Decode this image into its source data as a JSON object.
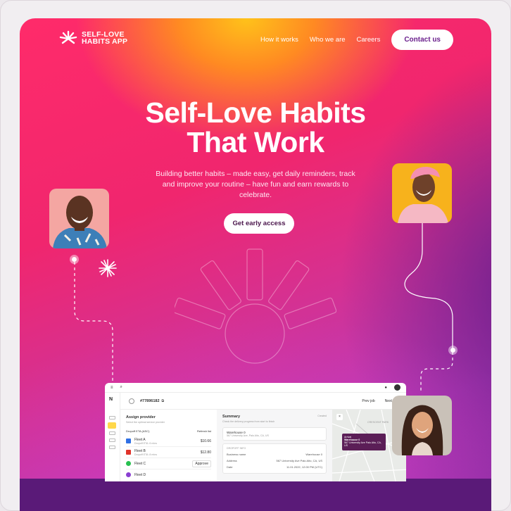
{
  "brand": {
    "name_line1": "SELF-LOVE",
    "name_line2": "HABITS APP"
  },
  "nav": {
    "items": [
      "How it works",
      "Who we are",
      "Careers"
    ],
    "contact": "Contact us"
  },
  "hero": {
    "title_line1": "Self-Love Habits",
    "title_line2": "That Work",
    "subtitle": "Building better habits – made easy, get daily reminders, track and improve your routine – have fun and earn rewards to celebrate.",
    "cta": "Get early access"
  },
  "app_preview": {
    "order_id": "#77896182",
    "prev_job": "Prev job",
    "next_job": "Next job",
    "assign": {
      "title": "Assign provider",
      "subtitle": "Select the optimal service provider",
      "dropdown": "Dropoff ETA (ASC)",
      "refresh": "Refresh list"
    },
    "fleets": [
      {
        "name": "Fleet A",
        "sub": "Dropoff ETA: 6 mins",
        "price": "$10.66",
        "color": "#2f6fe4"
      },
      {
        "name": "Fleet B",
        "sub": "Dropoff ETA: 8 mins",
        "price": "$12.80",
        "color": "#e0332a"
      },
      {
        "name": "Fleet C",
        "sub": "",
        "price": "Approve",
        "color": "#27c04f"
      },
      {
        "name": "Fleet D",
        "sub": "",
        "price": "",
        "color": "#8a3fd1"
      }
    ],
    "summary": {
      "title": "Summary",
      "subtitle": "Check the delivery progress from start to finish",
      "status": "Created",
      "warehouse": "Warehouse 0",
      "address_short": "567 University Ave, Palo Alto, CA, US",
      "section": "DROPOFF INFO",
      "row_labels": [
        "Business name",
        "Address",
        "Date"
      ],
      "row_values": [
        "Warehouse 0",
        "567 University Ave Palo Alto, CA, US",
        "11.01.2022, 12:00 PM (UTC)"
      ]
    },
    "map": {
      "popup_title": "Arrival",
      "popup_line1": "Warehouse 0",
      "popup_line2": "567 University Ave Palo Alto, CA, US",
      "label": "CRESCENT PARK"
    }
  }
}
